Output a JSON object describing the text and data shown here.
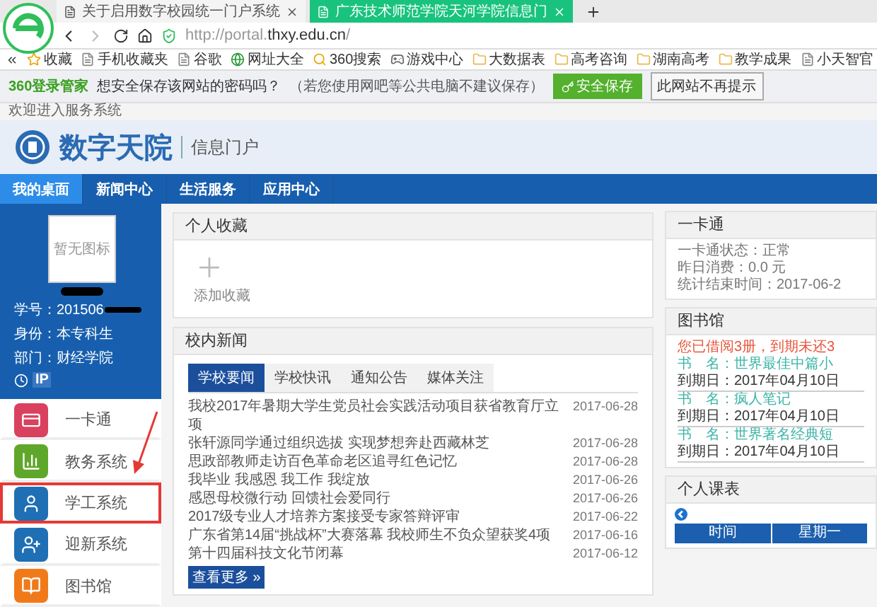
{
  "browser": {
    "tabs": [
      {
        "title": "关于启用数字校园统一门户系统",
        "selected": false
      },
      {
        "title": "广东技术师范学院天河学院信息门",
        "selected": true
      }
    ],
    "address": {
      "prefix": "http://portal.",
      "domain": "thxy.edu.cn",
      "path": "/"
    },
    "bookmarks": [
      {
        "label": "收藏",
        "kind": "star"
      },
      {
        "label": "手机收藏夹",
        "kind": "page"
      },
      {
        "label": "谷歌",
        "kind": "page"
      },
      {
        "label": "网址大全",
        "kind": "globe"
      },
      {
        "label": "360搜索",
        "kind": "search"
      },
      {
        "label": "游戏中心",
        "kind": "game"
      },
      {
        "label": "大数据表",
        "kind": "folder"
      },
      {
        "label": "高考咨询",
        "kind": "folder"
      },
      {
        "label": "湖南高考",
        "kind": "folder"
      },
      {
        "label": "教学成果",
        "kind": "folder"
      },
      {
        "label": "小天智官",
        "kind": "page"
      }
    ],
    "password_bar": {
      "brand": "360登录管家",
      "question": "想安全保存该网站的密码吗？",
      "hint": "（若您使用网吧等公共电脑不建议保存）",
      "save_button": "安全保存",
      "dismiss_button": "此网站不再提示"
    }
  },
  "welcome": "欢迎进入服务系统",
  "portal": {
    "logo_title": "数字天院",
    "subtitle": "信息门户"
  },
  "nav": [
    {
      "label": "我的桌面",
      "selected": true
    },
    {
      "label": "新闻中心",
      "selected": false
    },
    {
      "label": "生活服务",
      "selected": false
    },
    {
      "label": "应用中心",
      "selected": false
    }
  ],
  "profile": {
    "avatar_text": "暂无图标",
    "student_id": "学号：201506",
    "identity": "身份：本专科生",
    "department": "部门：财经学院",
    "ip_label": "IP"
  },
  "sidebar": {
    "items": [
      {
        "label": "一卡通",
        "color": "#d9415f",
        "highlighted": false
      },
      {
        "label": "教务系统",
        "color": "#5fa72a",
        "highlighted": false
      },
      {
        "label": "学工系统",
        "color": "#1f6fb5",
        "highlighted": true
      },
      {
        "label": "迎新系统",
        "color": "#1f6fb5",
        "highlighted": false
      },
      {
        "label": "图书馆",
        "color": "#f07a1a",
        "highlighted": false
      }
    ]
  },
  "favorites": {
    "title": "个人收藏",
    "add_label": "添加收藏"
  },
  "news": {
    "title": "校内新闻",
    "tabs": [
      {
        "label": "学校要闻",
        "selected": true
      },
      {
        "label": "学校快讯",
        "selected": false
      },
      {
        "label": "通知公告",
        "selected": false
      },
      {
        "label": "媒体关注",
        "selected": false
      }
    ],
    "rows": [
      {
        "title": "我校2017年暑期大学生党员社会实践活动项目获省教育厅立项",
        "date": "2017-06-28"
      },
      {
        "title": "张轩源同学通过组织选拔 实现梦想奔赴西藏林芝",
        "date": "2017-06-28"
      },
      {
        "title": "思政部教师走访百色革命老区追寻红色记忆",
        "date": "2017-06-28"
      },
      {
        "title": "我毕业 我感恩 我工作 我绽放",
        "date": "2017-06-26"
      },
      {
        "title": "感恩母校微行动 回馈社会爱同行",
        "date": "2017-06-26"
      },
      {
        "title": "2017级专业人才培养方案接受专家答辩评审",
        "date": "2017-06-22"
      },
      {
        "title": "广东省第14届“挑战杯”大赛落幕 我校师生不负众望获奖4项",
        "date": "2017-06-16"
      },
      {
        "title": "第十四届科技文化节闭幕",
        "date": "2017-06-12"
      }
    ],
    "more_button": "查看更多 »"
  },
  "card": {
    "title": "一卡通",
    "lines": [
      "一卡通状态：正常",
      "昨日消费：0.0 元",
      "统计结束时间：2017-06-2"
    ]
  },
  "library": {
    "title": "图书馆",
    "lines": [
      {
        "text": "您已借阅3册，到期未还3",
        "kind": "notice"
      },
      {
        "text": "书　名：世界最佳中篇小",
        "kind": "book"
      },
      {
        "text": "到期日：2017年04月10日",
        "kind": "due"
      },
      {
        "text": "书　名：疯人笔记",
        "kind": "book"
      },
      {
        "text": "到期日：2017年04月10日",
        "kind": "due"
      },
      {
        "text": "书　名：世界著名经典短",
        "kind": "book"
      },
      {
        "text": "到期日：2017年04月10日",
        "kind": "due"
      }
    ]
  },
  "schedule": {
    "title": "个人课表",
    "columns": [
      "时间",
      "星期一"
    ]
  }
}
